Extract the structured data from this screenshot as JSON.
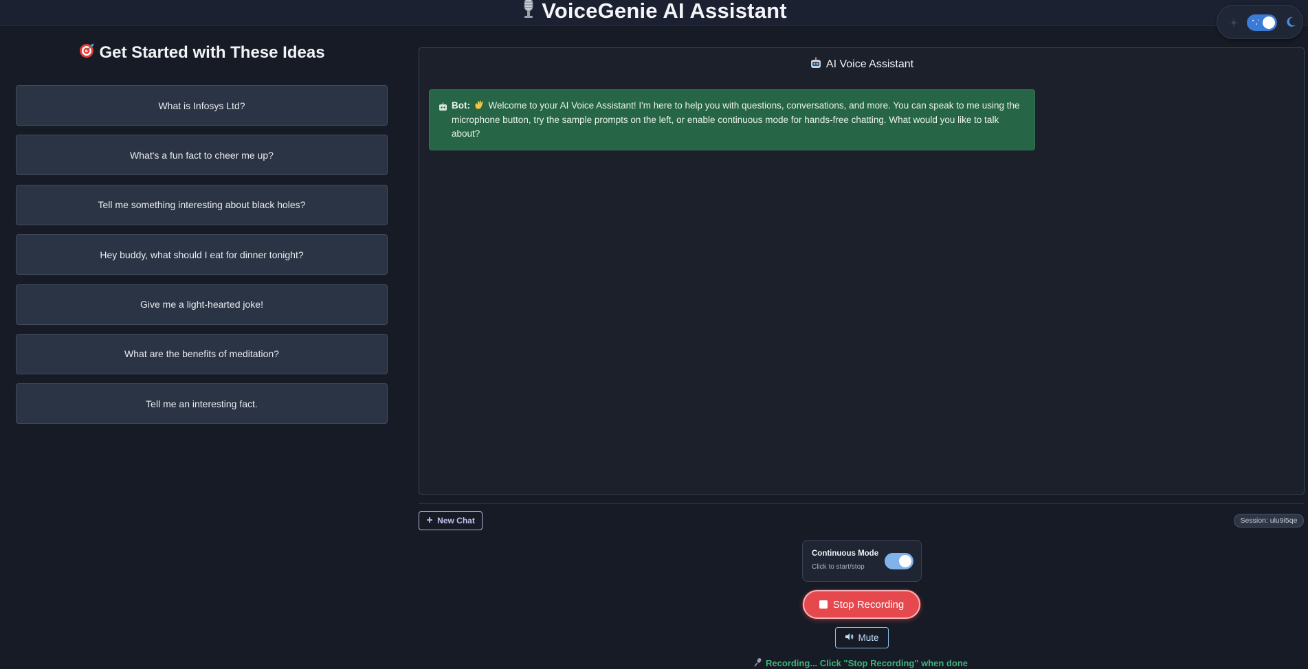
{
  "header": {
    "title": "VoiceGenie AI Assistant",
    "title_icon": "microphone-icon"
  },
  "theme_toggle": {
    "state": "dark",
    "icons": [
      "sun-icon",
      "stars-icon",
      "moon-icon"
    ],
    "accent": "#3a7bd5"
  },
  "sidebar": {
    "title": "Get Started with These Ideas",
    "title_icon": "target-icon",
    "prompts": [
      "What is Infosys Ltd?",
      "What's a fun fact to cheer me up?",
      "Tell me something interesting about black holes?",
      "Hey buddy, what should I eat for dinner tonight?",
      "Give me a light-hearted joke!",
      "What are the benefits of meditation?",
      "Tell me an interesting fact."
    ]
  },
  "chat": {
    "header": "AI Voice Assistant",
    "header_icon": "robot-icon",
    "messages": [
      {
        "sender": "Bot:",
        "icon": "robot-icon",
        "emoji": "wave-icon",
        "text": "Welcome to your AI Voice Assistant! I'm here to help you with questions, conversations, and more. You can speak to me using the microphone button, try the sample prompts on the left, or enable continuous mode for hands-free chatting. What would you like to talk about?",
        "color": "#266545"
      }
    ]
  },
  "controls": {
    "new_chat_label": "New Chat",
    "session_label": "Session: ulu9i5qe",
    "continuous_mode": {
      "title": "Continuous Mode",
      "subtitle": "Click to start/stop",
      "enabled": true
    },
    "stop_label": "Stop Recording",
    "stop_color": "#e5484d",
    "mute_label": "Mute",
    "status_text": "Recording... Click \"Stop Recording\" when done",
    "status_color": "#3fb27a"
  }
}
